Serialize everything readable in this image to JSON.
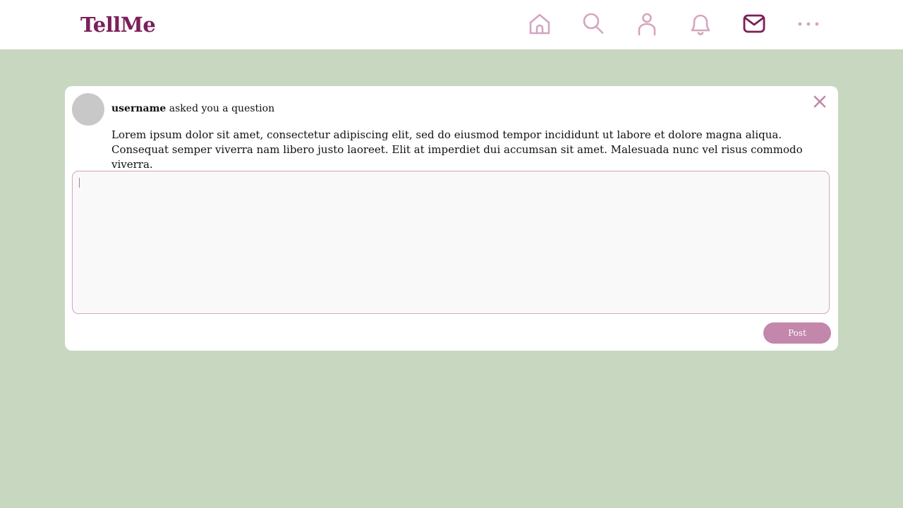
{
  "app": {
    "title": "TellMe"
  },
  "nav": {
    "items": [
      {
        "name": "home",
        "icon": "home-icon",
        "active": false
      },
      {
        "name": "search",
        "icon": "search-icon",
        "active": false
      },
      {
        "name": "profile",
        "icon": "user-icon",
        "active": false
      },
      {
        "name": "notifications",
        "icon": "bell-icon",
        "active": false
      },
      {
        "name": "messages",
        "icon": "mail-icon",
        "active": true
      },
      {
        "name": "more",
        "icon": "more-icon",
        "active": false
      }
    ]
  },
  "question_card": {
    "username": "username",
    "asked_text": " asked you a question",
    "question_text": "Lorem ipsum dolor sit amet, consectetur adipiscing elit, sed do eiusmod tempor incididunt ut labore et dolore magna aliqua. Consequat semper viverra nam libero justo laoreet. Elit at imperdiet dui accumsan sit amet. Malesuada nunc vel risus commodo viverra.",
    "answer_value": "",
    "post_label": "Post"
  },
  "colors": {
    "brand": "#7b1f5a",
    "icon_inactive": "#d4a5bf",
    "icon_active": "#7b1f5a",
    "page_background": "#c8d7c0",
    "button": "#c287aa",
    "close": "#c287aa"
  }
}
